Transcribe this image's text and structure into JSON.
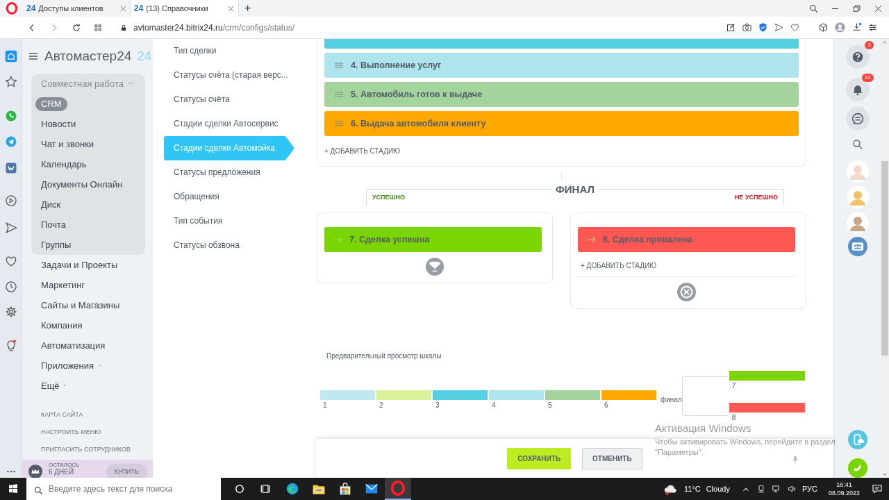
{
  "browser": {
    "tabs": [
      {
        "favicon": "24",
        "title": "Доступы клиентов",
        "selected": false
      },
      {
        "favicon": "24",
        "title": "(13) Справочники",
        "selected": true
      }
    ],
    "new_tab": "+",
    "url": {
      "host": "avtomaster24.bitrix24.ru",
      "path": "/crm/configs/status/"
    }
  },
  "portal": {
    "title": "Автомастер24",
    "badge": "24"
  },
  "menu": {
    "group": {
      "title": "Совместная работа",
      "expanded": true,
      "items": [
        {
          "label": "CRM",
          "selected": true
        },
        {
          "label": "Новости",
          "selected": false
        },
        {
          "label": "Чат и звонки",
          "selected": false
        },
        {
          "label": "Календарь",
          "selected": false
        },
        {
          "label": "Документы Онлайн",
          "selected": false
        },
        {
          "label": "Диск",
          "selected": false
        },
        {
          "label": "Почта",
          "selected": false
        },
        {
          "label": "Группы",
          "selected": false
        }
      ]
    },
    "items": [
      {
        "label": "Задачи и Проекты",
        "kind": "link"
      },
      {
        "label": "Маркетинг",
        "kind": "link"
      },
      {
        "label": "Сайты и Магазины",
        "kind": "link"
      },
      {
        "label": "Компания",
        "kind": "link"
      },
      {
        "label": "Автоматизация",
        "kind": "link"
      },
      {
        "label": "Приложения",
        "kind": "dropdown"
      },
      {
        "label": "Ещё",
        "kind": "more"
      }
    ],
    "links": [
      "КАРТА САЙТА",
      "НАСТРОИТЬ МЕНЮ",
      "ПРИГЛАСИТЬ СОТРУДНИКОВ"
    ],
    "trial": {
      "caption": "ОСТАЛОСЬ",
      "days": "6 ДНЕЙ",
      "button": "КУПИТЬ"
    }
  },
  "settings_nav": [
    {
      "label": "Тип сделки",
      "selected": false
    },
    {
      "label": "Статусы счёта (старая верс...",
      "selected": false
    },
    {
      "label": "Статусы счёта",
      "selected": false
    },
    {
      "label": "Стадии сделки Автосервис",
      "selected": false
    },
    {
      "label": "Стадии сделки Автомойка",
      "selected": true
    },
    {
      "label": "Статусы предложения",
      "selected": false
    },
    {
      "label": "Обращения",
      "selected": false
    },
    {
      "label": "Тип события",
      "selected": false
    },
    {
      "label": "Статусы обзвона",
      "selected": false
    }
  ],
  "stages": [
    {
      "color": "#55d0e0"
    },
    {
      "label": "4. Выполнение услуг",
      "color": "#ade4ed"
    },
    {
      "label": "5. Автомобиль готов к выдаче",
      "color": "#a3d49b"
    },
    {
      "label": "6. Выдача автомобиля клиенту",
      "color": "#ffa900"
    }
  ],
  "add_stage": "+ ДОБАВИТЬ СТАДИЮ",
  "final": {
    "title": "ФИНАЛ",
    "success_label": "УСПЕШНО",
    "failure_label": "НЕ УСПЕШНО",
    "success": [
      {
        "label": "7. Сделка успешна",
        "color": "#7bd500"
      }
    ],
    "failure": [
      {
        "label": "8. Сделка провалена",
        "color": "#ff5752"
      }
    ],
    "add_stage": "+ ДОБАВИТЬ СТАДИЮ"
  },
  "preview": {
    "title": "Предварительный просмотр шкалы",
    "segments": [
      {
        "number": "1",
        "color": "#bfe9f0"
      },
      {
        "number": "2",
        "color": "#dbf09a"
      },
      {
        "number": "3",
        "color": "#55d0e0"
      },
      {
        "number": "4",
        "color": "#ade4ed"
      },
      {
        "number": "5",
        "color": "#a3d49b"
      },
      {
        "number": "6",
        "color": "#ffa900"
      }
    ],
    "final_label": "финал",
    "final_segments": [
      {
        "number": "7",
        "color": "#7bd500"
      },
      {
        "number": "8",
        "color": "#ff5752"
      }
    ]
  },
  "footer": {
    "buttons": [
      {
        "label": "СОХРАНИТЬ",
        "kind": "primary"
      },
      {
        "label": "ОТМЕНИТЬ",
        "kind": "secondary"
      }
    ]
  },
  "right_panel": {
    "help_badge": "3",
    "notifications_badge": "13"
  },
  "activation": {
    "title": "Активация Windows",
    "text": "Чтобы активировать Windows, перейдите в раздел \"Параметры\"."
  },
  "taskbar": {
    "search_placeholder": "Введите здесь текст для поиска",
    "apps": [
      {
        "kind": "edge",
        "selected": false
      },
      {
        "kind": "folder",
        "selected": false
      },
      {
        "kind": "store",
        "selected": false
      },
      {
        "kind": "mail",
        "selected": false
      },
      {
        "kind": "opera",
        "selected": true
      }
    ],
    "temperature": "11°C",
    "weather": "Cloudy",
    "language": "РУС",
    "time": "16:41",
    "date": "08.09.2022"
  }
}
